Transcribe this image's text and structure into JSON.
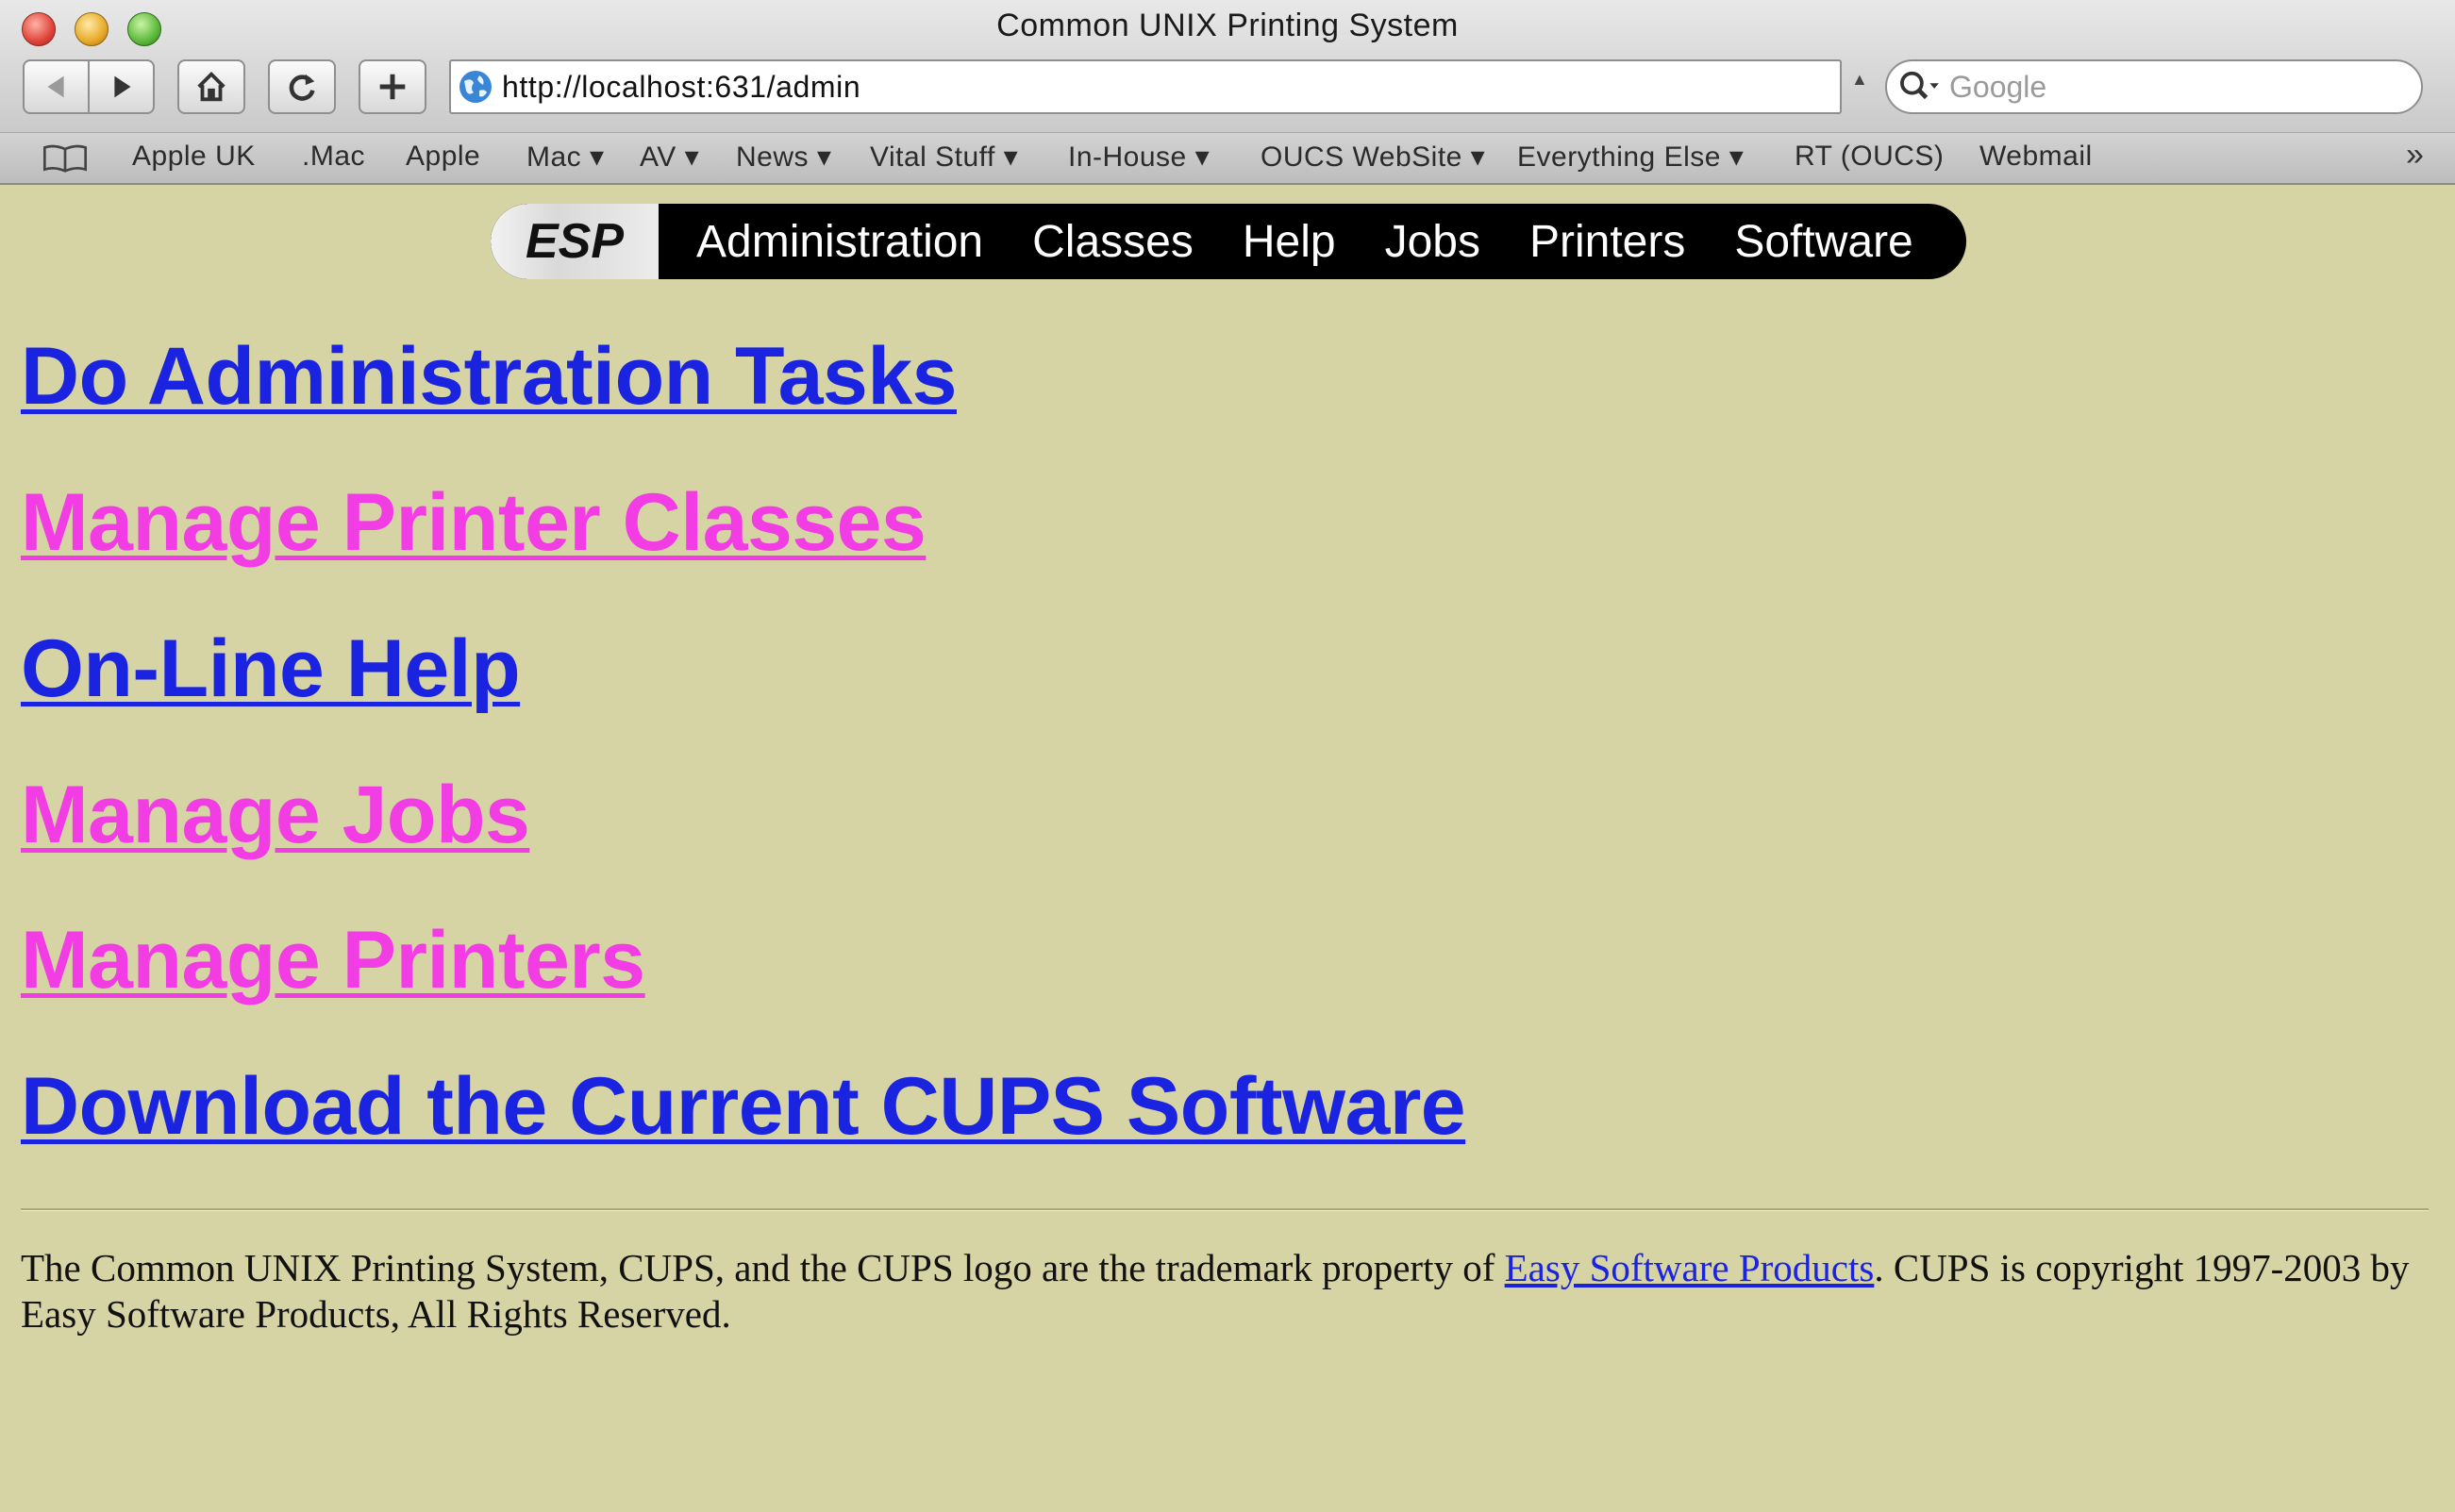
{
  "window": {
    "title": "Common UNIX Printing System"
  },
  "toolbar": {
    "url": "http://localhost:631/admin",
    "search_placeholder": "Google",
    "icons": [
      "back-arrow-icon",
      "forward-arrow-icon",
      "home-icon",
      "reload-icon",
      "add-bookmark-icon",
      "globe-icon",
      "search-icon"
    ]
  },
  "bookmarks": {
    "items": [
      "Apple UK",
      ".Mac",
      "Apple",
      "Mac ▾",
      "AV ▾",
      "News ▾",
      "Vital Stuff ▾",
      "In-House ▾",
      "OUCS WebSite ▾",
      "Everything Else ▾",
      "RT (OUCS)",
      "Webmail"
    ],
    "more": "»"
  },
  "cups_nav": {
    "logo": "ESP",
    "items": [
      "Administration",
      "Classes",
      "Help",
      "Jobs",
      "Printers",
      "Software"
    ]
  },
  "links": [
    {
      "label": "Do Administration Tasks",
      "color": "#1a24e0"
    },
    {
      "label": "Manage Printer Classes",
      "color": "#f23ce4"
    },
    {
      "label": "On-Line Help",
      "color": "#1a24e0"
    },
    {
      "label": "Manage Jobs",
      "color": "#f23ce4"
    },
    {
      "label": "Manage Printers",
      "color": "#f23ce4"
    },
    {
      "label": "Download the Current CUPS Software",
      "color": "#1a24e0"
    }
  ],
  "footer": {
    "text_before": "The Common UNIX Printing System, CUPS, and the CUPS logo are the trademark property of ",
    "link": "Easy Software Products",
    "text_after": ". CUPS is copyright 1997-2003 by Easy Software Products, All Rights Reserved."
  },
  "colors": {
    "page_background": "#d6d3a5",
    "visited_link": "#f23ce4",
    "link": "#1a24e0"
  }
}
